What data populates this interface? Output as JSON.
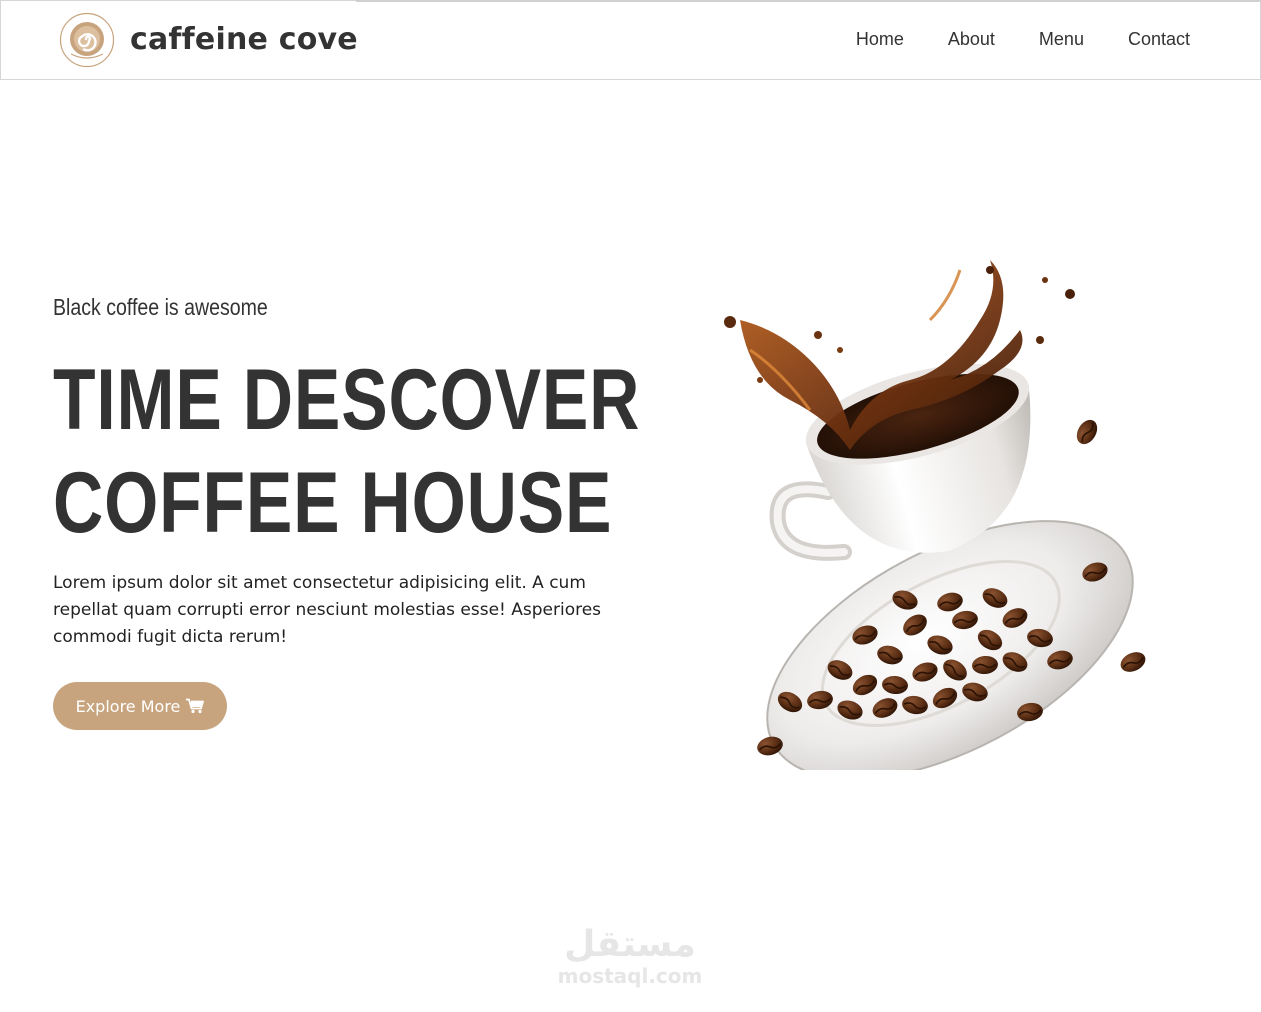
{
  "brand": {
    "name": "caffeine cove",
    "logo_icon": "coffee-cup-swirl-icon"
  },
  "nav": {
    "items": [
      {
        "label": "Home"
      },
      {
        "label": "About"
      },
      {
        "label": "Menu"
      },
      {
        "label": "Contact"
      }
    ]
  },
  "hero": {
    "subtitle": "Black coffee is awesome",
    "title_line1": "TIME DESCOVER",
    "title_line2": "COFFEE HOUSE",
    "description": "Lorem ipsum dolor sit amet consectetur adipisicing elit. A cum repellat quam corrupti error nesciunt molestias esse! Asperiores commodi fugit dicta rerum!",
    "button_label": "Explore More",
    "button_icon": "shopping-cart-icon",
    "image": "coffee-cup-splash-with-beans"
  },
  "watermark": {
    "arabic": "مستقل",
    "url": "mostaql.com"
  },
  "colors": {
    "accent": "#c8a47e",
    "text": "#333333",
    "background": "#ffffff"
  }
}
